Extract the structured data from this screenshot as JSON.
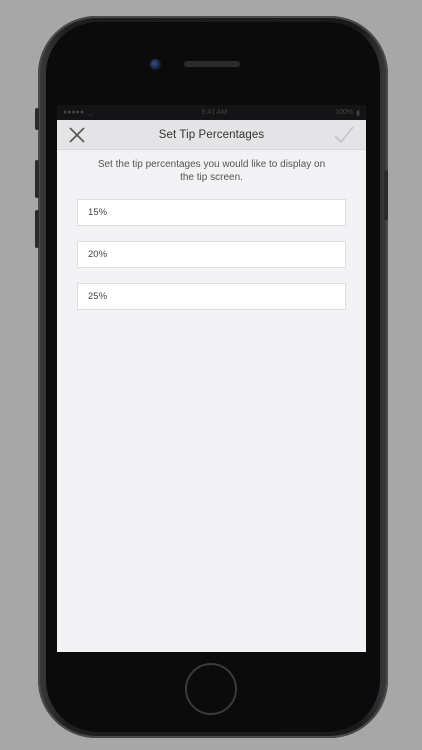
{
  "status_bar": {
    "carrier": "●●●●●",
    "time": "9:41 AM",
    "battery": "100%"
  },
  "nav": {
    "title": "Set Tip Percentages",
    "close_icon": "close-icon",
    "confirm_icon": "checkmark-icon"
  },
  "instructions": "Set the tip percentages you would like to display on the tip screen.",
  "tips": [
    {
      "value": "15%"
    },
    {
      "value": "20%"
    },
    {
      "value": "25%"
    }
  ],
  "colors": {
    "background": "#a7a7a7",
    "screen": "#f2f2f4",
    "nav_bar": "#e4e4e6",
    "field": "#ffffff"
  }
}
